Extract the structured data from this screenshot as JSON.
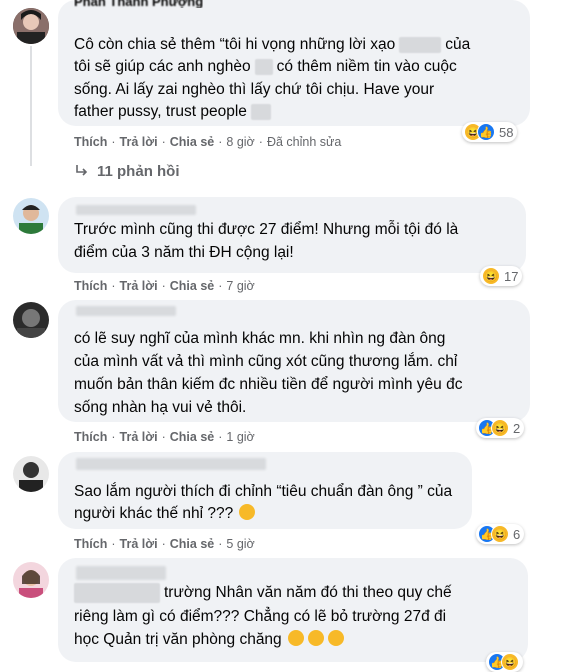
{
  "comments": [
    {
      "author": "Phan Thanh Phượng",
      "lines": [
        "Cô còn chia sẻ thêm “tôi hi vọng những lời xạo",
        "của",
        "tôi sẽ giúp các anh nghèo",
        "có thêm niềm tin vào cuộc",
        "sống. Ai lấy zai nghèo thì lấy chứ tôi chịu. Have your",
        "father pussy, trust people"
      ],
      "actions": {
        "like": "Thích",
        "reply": "Trả lời",
        "share": "Chia sẻ",
        "time": "8 giờ",
        "edited": "Đã chỉnh sửa"
      },
      "reaction_count": "58",
      "replies_label": "11 phản hồi"
    },
    {
      "lines": [
        "Trước mình cũng thi được 27 điểm! Nhưng mỗi tội đó là",
        "điểm của 3 năm thi ĐH cộng lại!"
      ],
      "actions": {
        "like": "Thích",
        "reply": "Trả lời",
        "share": "Chia sẻ",
        "time": "7 giờ"
      },
      "reaction_count": "17"
    },
    {
      "lines": [
        "có lẽ suy nghĩ của mình khác mn. khi nhìn ng đàn ông",
        "của mình vất vả thì mình cũng xót cũng thương lắm. chỉ",
        "muốn bản thân kiếm đc nhiều tiền để người mình yêu đc",
        "sống nhàn hạ vui vẻ thôi."
      ],
      "actions": {
        "like": "Thích",
        "reply": "Trả lời",
        "share": "Chia sẻ",
        "time": "1 giờ"
      },
      "reaction_count": "2"
    },
    {
      "lines": [
        "Sao lắm người thích đi chỉnh “tiêu chuẩn đàn ông ” của",
        "người khác thế nhỉ ???"
      ],
      "actions": {
        "like": "Thích",
        "reply": "Trả lời",
        "share": "Chia sẻ",
        "time": "5 giờ"
      },
      "reaction_count": "6"
    },
    {
      "lines": [
        "trường Nhân văn năm đó thi theo quy chế",
        "riêng làm gì có điểm??? Chẳng có lẽ bỏ trường 27đ đi",
        "học Quản trị văn phòng chăng"
      ]
    }
  ],
  "icons": {
    "haha": "haha-emoji-icon",
    "like": "like-thumb-icon",
    "reply": "reply-arrow-icon"
  },
  "colors": {
    "bubble": "#f0f2f5",
    "meta": "#65676b",
    "like": "#1877f2",
    "haha": "#f7b928"
  }
}
